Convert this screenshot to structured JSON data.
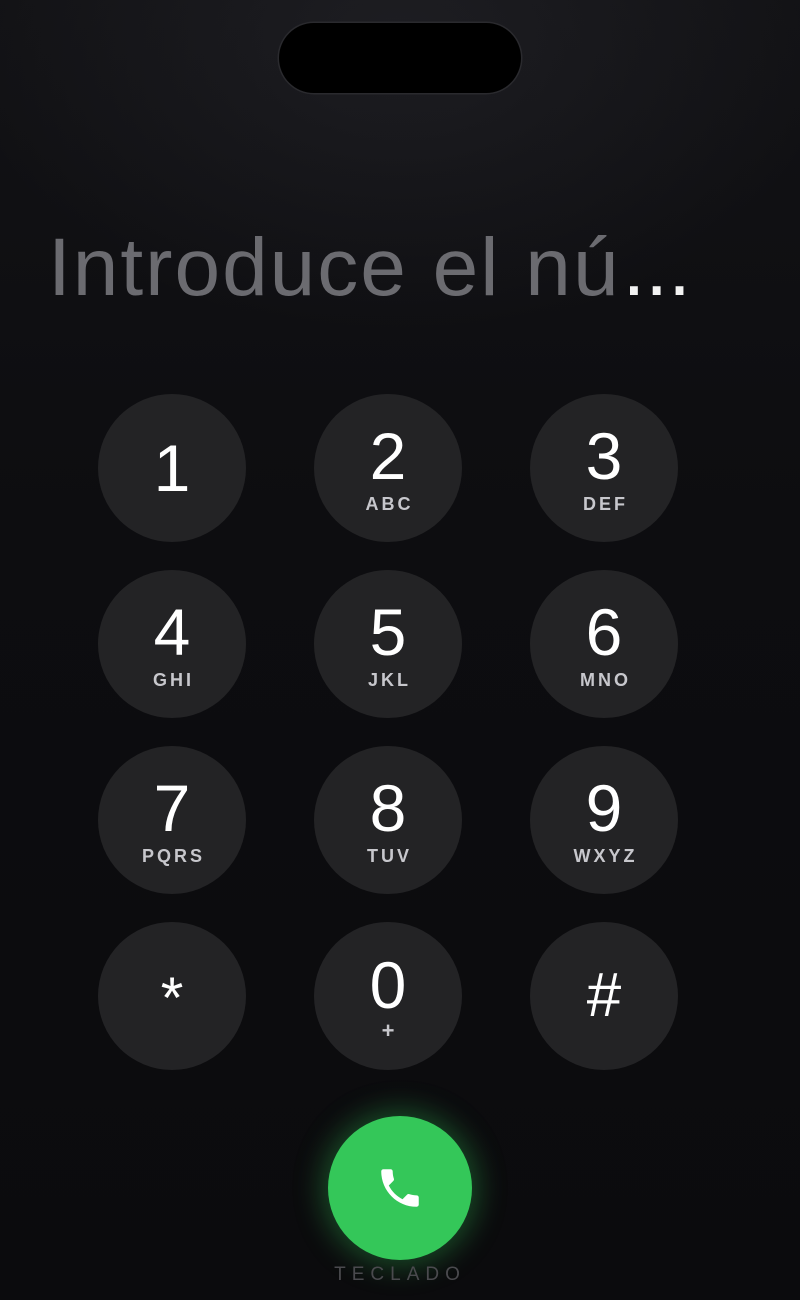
{
  "display": {
    "placeholder": "Introduce el nú",
    "ellipsis": "..."
  },
  "keypad": {
    "keys": [
      {
        "digit": "1",
        "letters": ""
      },
      {
        "digit": "2",
        "letters": "ABC"
      },
      {
        "digit": "3",
        "letters": "DEF"
      },
      {
        "digit": "4",
        "letters": "GHI"
      },
      {
        "digit": "5",
        "letters": "JKL"
      },
      {
        "digit": "6",
        "letters": "MNO"
      },
      {
        "digit": "7",
        "letters": "PQRS"
      },
      {
        "digit": "8",
        "letters": "TUV"
      },
      {
        "digit": "9",
        "letters": "WXYZ"
      },
      {
        "digit": "*",
        "letters": ""
      },
      {
        "digit": "0",
        "letters": "+"
      },
      {
        "digit": "#",
        "letters": ""
      }
    ]
  },
  "call": {
    "icon": "phone-icon",
    "color": "#34c759"
  },
  "tab": {
    "label": "TECLADO"
  }
}
